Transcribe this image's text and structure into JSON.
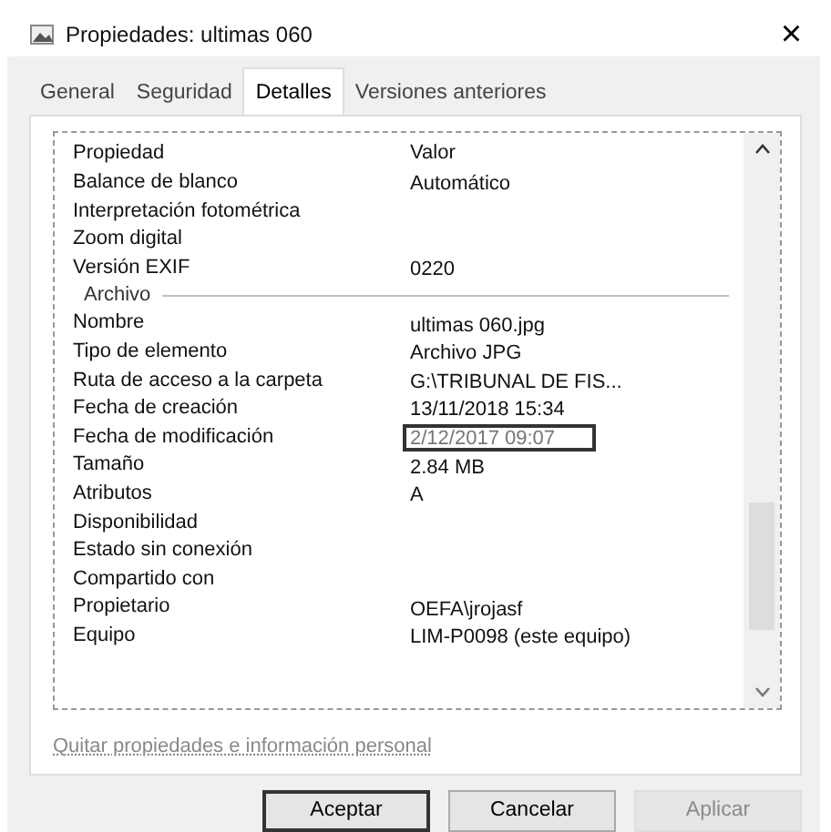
{
  "window": {
    "title": "Propiedades: ultimas 060",
    "close": "×"
  },
  "tabs": [
    {
      "label": "General",
      "selected": false
    },
    {
      "label": "Seguridad",
      "selected": false
    },
    {
      "label": "Detalles",
      "selected": true
    },
    {
      "label": "Versiones anteriores",
      "selected": false
    }
  ],
  "table": {
    "columns": [
      "Propiedad",
      "Valor"
    ],
    "rows": [
      {
        "kind": "row",
        "property": "Balance de blanco",
        "value": "Automático",
        "marked": false
      },
      {
        "kind": "row",
        "property": "Interpretación fotométrica",
        "value": "",
        "marked": false
      },
      {
        "kind": "row",
        "property": "Zoom digital",
        "value": "",
        "marked": false
      },
      {
        "kind": "row",
        "property": "Versión EXIF",
        "value": "0220",
        "marked": false
      },
      {
        "kind": "group",
        "label": "Archivo"
      },
      {
        "kind": "row",
        "property": "Nombre",
        "value": "ultimas 060.jpg",
        "marked": false
      },
      {
        "kind": "row",
        "property": "Tipo de elemento",
        "value": "Archivo JPG",
        "marked": false
      },
      {
        "kind": "row",
        "property": "Ruta de acceso a la carpeta",
        "value": "G:\\TRIBUNAL DE FIS...",
        "marked": false
      },
      {
        "kind": "row",
        "property": "Fecha de creación",
        "value": "13/11/2018 15:34",
        "marked": false
      },
      {
        "kind": "row",
        "property": "Fecha de modificación",
        "value": "2/12/2017 09:07",
        "marked": true
      },
      {
        "kind": "row",
        "property": "Tamaño",
        "value": "2.84 MB",
        "marked": false
      },
      {
        "kind": "row",
        "property": "Atributos",
        "value": "A",
        "marked": false
      },
      {
        "kind": "row",
        "property": "Disponibilidad",
        "value": "",
        "marked": false
      },
      {
        "kind": "row",
        "property": "Estado sin conexión",
        "value": "",
        "marked": false
      },
      {
        "kind": "row",
        "property": "Compartido con",
        "value": "",
        "marked": false
      },
      {
        "kind": "row",
        "property": "Propietario",
        "value": "OEFA\\jrojasf",
        "marked": false
      },
      {
        "kind": "row",
        "property": "Equipo",
        "value": "LIM-P0098 (este equipo)",
        "marked": false
      }
    ]
  },
  "link": "Quitar propiedades e información personal",
  "buttons": [
    {
      "label": "Aceptar",
      "default": true,
      "disabled": false
    },
    {
      "label": "Cancelar",
      "default": false,
      "disabled": false
    },
    {
      "label": "Aplicar",
      "default": false,
      "disabled": true
    }
  ]
}
